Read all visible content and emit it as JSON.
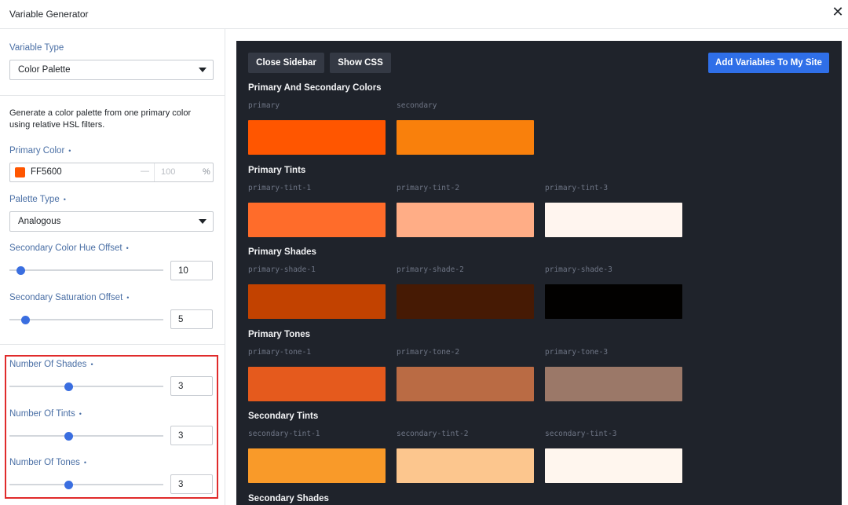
{
  "window": {
    "title": "Variable Generator",
    "close_glyph": "✕"
  },
  "sidebar": {
    "variable_type": {
      "label": "Variable Type",
      "value": "Color Palette"
    },
    "description": "Generate a color palette from one primary color using relative HSL filters.",
    "primary_color": {
      "label": "Primary Color",
      "hex": "FF5600",
      "swatch": "#FF5600",
      "dash": "—",
      "opacity_placeholder": "100",
      "pct": "%"
    },
    "palette_type": {
      "label": "Palette Type",
      "value": "Analogous"
    },
    "hue_offset": {
      "label": "Secondary Color Hue Offset",
      "value": "10",
      "level": 0.05
    },
    "sat_offset": {
      "label": "Secondary Saturation Offset",
      "value": "5",
      "level": 0.08
    },
    "shades": {
      "label": "Number Of Shades",
      "value": "3",
      "level": 0.38
    },
    "tints": {
      "label": "Number Of Tints",
      "value": "3",
      "level": 0.38
    },
    "tones": {
      "label": "Number Of Tones",
      "value": "3",
      "level": 0.38
    },
    "dot": "•"
  },
  "toolbar": {
    "close_sidebar": "Close Sidebar",
    "show_css": "Show CSS",
    "add_variables": "Add Variables To My Site"
  },
  "sections": [
    {
      "title": "Primary And Secondary Colors",
      "swatches": [
        {
          "name": "primary",
          "color": "#FF5600"
        },
        {
          "name": "secondary",
          "color": "#F9800C"
        }
      ]
    },
    {
      "title": "Primary Tints",
      "swatches": [
        {
          "name": "primary-tint-1",
          "color": "#FF6C2A"
        },
        {
          "name": "primary-tint-2",
          "color": "#FFAD86"
        },
        {
          "name": "primary-tint-3",
          "color": "#FFF5EF"
        }
      ]
    },
    {
      "title": "Primary Shades",
      "swatches": [
        {
          "name": "primary-shade-1",
          "color": "#C24200"
        },
        {
          "name": "primary-shade-2",
          "color": "#461A04"
        },
        {
          "name": "primary-shade-3",
          "color": "#020100"
        }
      ]
    },
    {
      "title": "Primary Tones",
      "swatches": [
        {
          "name": "primary-tone-1",
          "color": "#E55A1D"
        },
        {
          "name": "primary-tone-2",
          "color": "#BA6B44"
        },
        {
          "name": "primary-tone-3",
          "color": "#9B7868"
        }
      ]
    },
    {
      "title": "Secondary Tints",
      "swatches": [
        {
          "name": "secondary-tint-1",
          "color": "#F99A29"
        },
        {
          "name": "secondary-tint-2",
          "color": "#FCC68E"
        },
        {
          "name": "secondary-tint-3",
          "color": "#FFF6EE"
        }
      ]
    },
    {
      "title": "Secondary Shades",
      "swatches": []
    }
  ]
}
